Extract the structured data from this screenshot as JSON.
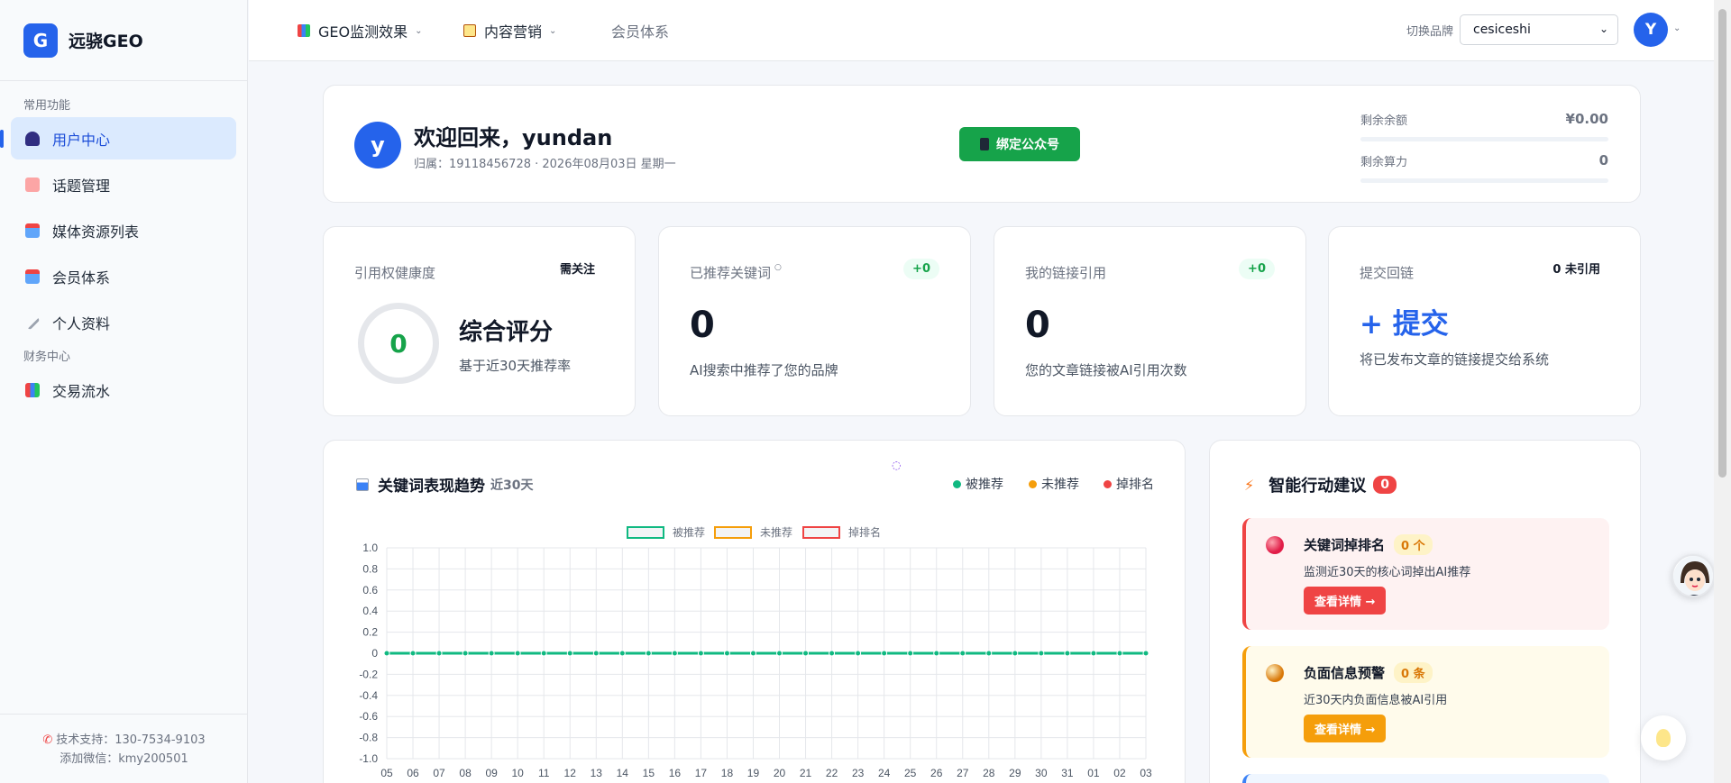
{
  "app": {
    "logo_letter": "G",
    "name": "远骁GEO"
  },
  "sidebar": {
    "section_common": "常用功能",
    "section_finance": "财务中心",
    "items": [
      {
        "label": "用户中心",
        "icon": "user-icon",
        "active": true
      },
      {
        "label": "话题管理",
        "icon": "memo-icon"
      },
      {
        "label": "媒体资源列表",
        "icon": "inbox-icon"
      },
      {
        "label": "会员体系",
        "icon": "inbox-icon"
      },
      {
        "label": "个人资料",
        "icon": "wrench-icon"
      },
      {
        "label": "交易流水",
        "icon": "bar-chart-icon"
      }
    ],
    "support": "技术支持：130-7534-9103",
    "wechat": "添加微信：kmy200501"
  },
  "header": {
    "nav": [
      {
        "label": "GEO监测效果",
        "icon": "bar-chart-icon"
      },
      {
        "label": "内容营销",
        "icon": "clipboard-icon"
      },
      {
        "label": "会员体系"
      }
    ],
    "switch_label": "切换品牌",
    "brand_value": "cesiceshi",
    "avatar_letter": "Y"
  },
  "welcome": {
    "avatar_letter": "y",
    "title": "欢迎回来，yundan",
    "subtitle": "归属：19118456728 · 2026年08月03日 星期一",
    "bind_button": "绑定公众号",
    "balance_label": "剩余余额",
    "balance_value": "¥0.00",
    "compute_label": "剩余算力",
    "compute_value": "0"
  },
  "stats": {
    "health": {
      "label": "引用权健康度",
      "tag": "需关注",
      "score": "0",
      "title": "综合评分",
      "desc": "基于近30天推荐率"
    },
    "keywords": {
      "label": "已推荐关键词",
      "delta": "+0",
      "value": "0",
      "desc": "AI搜索中推荐了您的品牌"
    },
    "links": {
      "label": "我的链接引用",
      "delta": "+0",
      "value": "0",
      "desc": "您的文章链接被AI引用次数"
    },
    "submit": {
      "label": "提交回链",
      "tag": "0 未引用",
      "action": "+ 提交",
      "desc": "将已发布文章的链接提交给系统"
    }
  },
  "trend": {
    "title": "关键词表现趋势",
    "range": "近30天",
    "dot_legend": [
      {
        "label": "被推荐",
        "color": "#10b981"
      },
      {
        "label": "未推荐",
        "color": "#f59e0b"
      },
      {
        "label": "掉排名",
        "color": "#ef4444"
      }
    ]
  },
  "chart_data": {
    "type": "line",
    "categories": [
      "05",
      "06",
      "07",
      "08",
      "09",
      "10",
      "11",
      "12",
      "13",
      "14",
      "15",
      "16",
      "17",
      "18",
      "19",
      "20",
      "21",
      "22",
      "23",
      "24",
      "25",
      "26",
      "27",
      "28",
      "29",
      "30",
      "31",
      "01",
      "02",
      "03"
    ],
    "series": [
      {
        "name": "被推荐",
        "color": "#10b981",
        "values": [
          0,
          0,
          0,
          0,
          0,
          0,
          0,
          0,
          0,
          0,
          0,
          0,
          0,
          0,
          0,
          0,
          0,
          0,
          0,
          0,
          0,
          0,
          0,
          0,
          0,
          0,
          0,
          0,
          0,
          0
        ]
      },
      {
        "name": "未推荐",
        "color": "#f59e0b",
        "values": [
          0,
          0,
          0,
          0,
          0,
          0,
          0,
          0,
          0,
          0,
          0,
          0,
          0,
          0,
          0,
          0,
          0,
          0,
          0,
          0,
          0,
          0,
          0,
          0,
          0,
          0,
          0,
          0,
          0,
          0
        ]
      },
      {
        "name": "掉排名",
        "color": "#ef4444",
        "values": [
          0,
          0,
          0,
          0,
          0,
          0,
          0,
          0,
          0,
          0,
          0,
          0,
          0,
          0,
          0,
          0,
          0,
          0,
          0,
          0,
          0,
          0,
          0,
          0,
          0,
          0,
          0,
          0,
          0,
          0
        ]
      }
    ],
    "yticks": [
      "1.0",
      "0.8",
      "0.6",
      "0.4",
      "0.2",
      "0",
      "-0.2",
      "-0.4",
      "-0.6",
      "-0.8",
      "-1.0"
    ],
    "ylim": [
      -1,
      1
    ],
    "grid": true,
    "legend_position": "top"
  },
  "actions": {
    "title": "智能行动建议",
    "count": "0",
    "items": [
      {
        "title": "关键词掉排名",
        "pill": "0 个",
        "desc": "监测近30天的核心词掉出AI推荐",
        "button": "查看详情 →"
      },
      {
        "title": "负面信息预警",
        "pill": "0 条",
        "desc": "近30天内负面信息被AI引用",
        "button": "查看详情 →"
      }
    ]
  }
}
